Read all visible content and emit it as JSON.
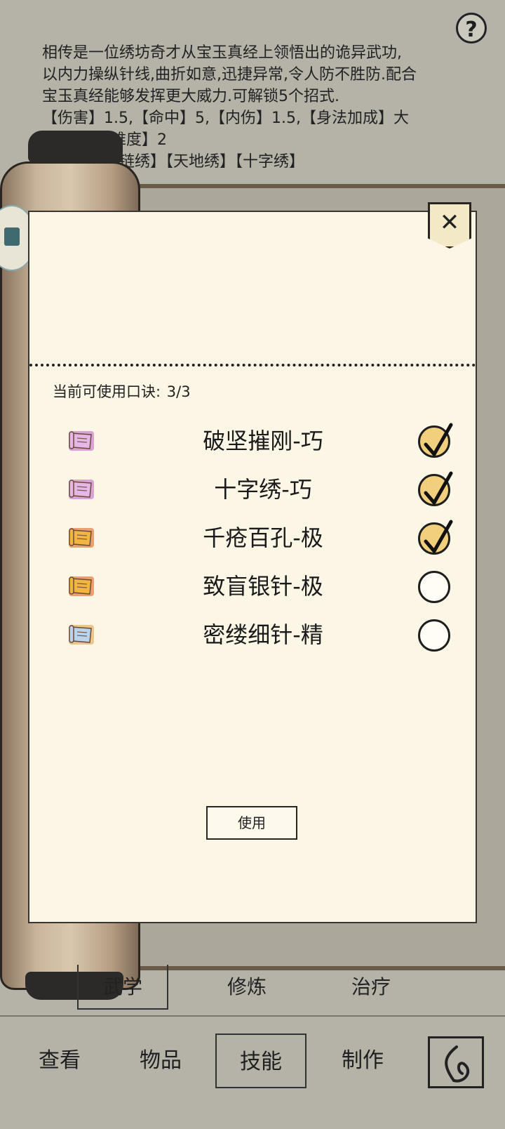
{
  "description": {
    "line1": "相传是一位绣坊奇才从宝玉真经上领悟出的诡异武功,",
    "line2": "以内力操纵针线,曲折如意,迅捷异常,令人防不胜防.配合",
    "line3": "宝玉真经能够发挥更大威力.可解锁5个招式.",
    "line4": "【伤害】1.5,【命中】5,【内伤】1.5,【身法加成】大",
    "line5": "难度】2",
    "line6": "链绣】【天地绣】【十字绣】"
  },
  "help_label": "?",
  "modal": {
    "close_label": "✕",
    "quota_label": "当前可使用口诀:",
    "quota_value": "3/3",
    "use_label": "使用",
    "skills": [
      {
        "name": "破坚摧刚-巧",
        "selected": true,
        "scroll_color": "#e6b6e6",
        "glow": "#c05cc8"
      },
      {
        "name": "十字绣-巧",
        "selected": true,
        "scroll_color": "#e6b6e6",
        "glow": "#c05cc8"
      },
      {
        "name": "千疮百孔-极",
        "selected": true,
        "scroll_color": "#f2b640",
        "glow": "#e05a10"
      },
      {
        "name": "致盲银针-极",
        "selected": false,
        "scroll_color": "#f2b640",
        "glow": "#e05a10"
      },
      {
        "name": "密缕细针-精",
        "selected": false,
        "scroll_color": "#b8d4ee",
        "glow": "#e0a040"
      }
    ]
  },
  "sub_tabs": {
    "martial": "武学",
    "cultivate": "修炼",
    "heal": "治疗"
  },
  "bottom_nav": {
    "view": "查看",
    "items": "物品",
    "skills": "技能",
    "craft": "制作"
  }
}
